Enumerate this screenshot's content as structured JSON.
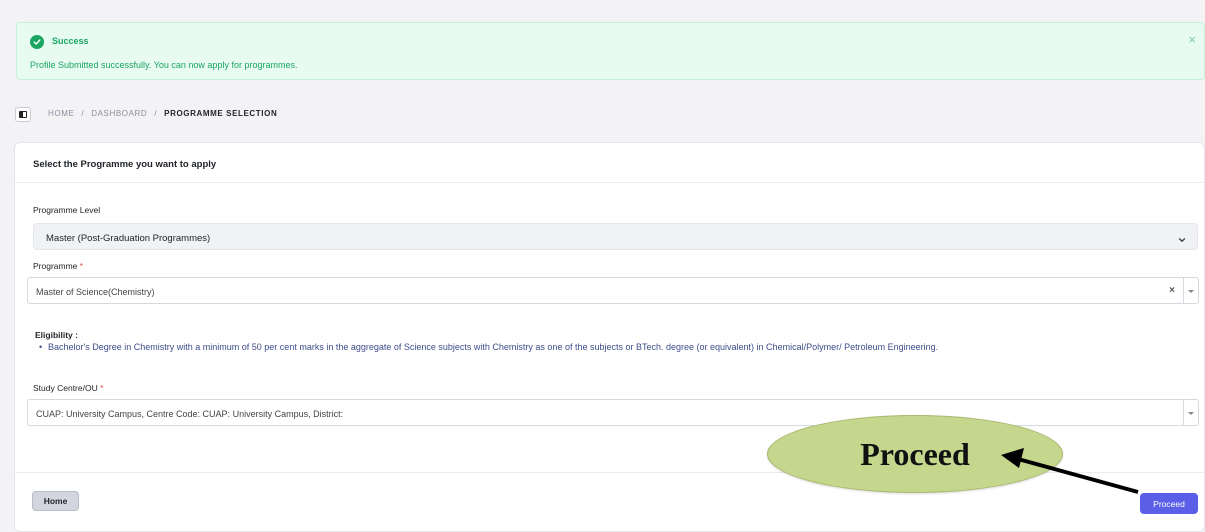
{
  "alert": {
    "title": "Success",
    "message": "Profile Submitted successfully. You can now apply for programmes.",
    "close_symbol": "×",
    "icon": "check-circle-icon",
    "color": "#1aa563"
  },
  "breadcrumb": {
    "items": [
      "HOME",
      "DASHBOARD",
      "PROGRAMME SELECTION"
    ],
    "separator": "/"
  },
  "card": {
    "title": "Select the Programme you want to apply"
  },
  "form": {
    "level_label": "Programme Level",
    "level_value": "Master (Post-Graduation Programmes)",
    "programme_label": "Programme",
    "programme_value": "Master of Science(Chemistry)",
    "required_mark": "*",
    "clear_symbol": "×",
    "eligibility_label": "Eligibility :",
    "eligibility_text": "Bachelor's Degree in Chemistry with a minimum of 50 per cent marks in the aggregate of Science subjects with Chemistry as one of the subjects or BTech. degree (or equivalent) in Chemical/Polymer/ Petroleum Engineering.",
    "centre_label": "Study Centre/OU",
    "centre_value": "CUAP: University Campus, Centre Code: CUAP: University Campus, District:"
  },
  "buttons": {
    "home_label": "Home",
    "proceed_label": "Proceed",
    "proceed_color": "#5b5fe8"
  },
  "annotation": {
    "callout_text": "Proceed",
    "callout_color": "#c5d68d"
  }
}
